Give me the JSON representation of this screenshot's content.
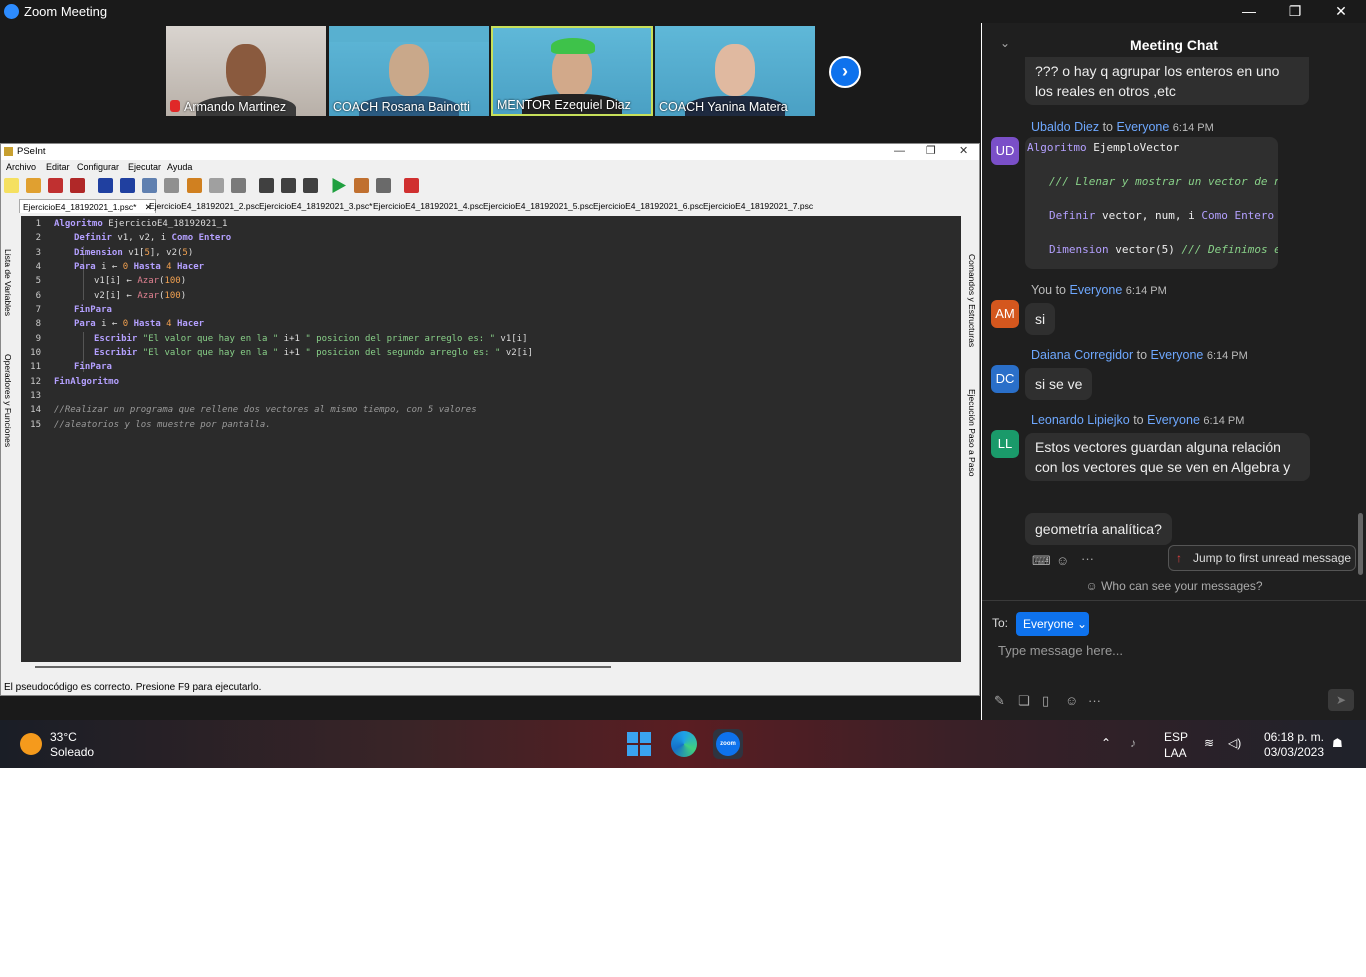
{
  "window": {
    "title": "Zoom Meeting",
    "minimize": "—",
    "restore": "❐",
    "close": "✕"
  },
  "participants": [
    {
      "name": "Armando Martinez",
      "muted": true
    },
    {
      "name": "COACH Rosana Bainotti",
      "muted": false
    },
    {
      "name": "MENTOR Ezequiel Diaz",
      "muted": false
    },
    {
      "name": "COACH Yanina Matera",
      "muted": false
    }
  ],
  "next_page_icon": "chevron-right-icon",
  "pseint": {
    "title": "PSeInt",
    "menu": [
      "Archivo",
      "Editar",
      "Configurar",
      "Ejecutar",
      "Ayuda"
    ],
    "tabs": [
      "EjercicioE4_18192021_1.psc*",
      "EjercicioE4_18192021_2.psc",
      "EjercicioE4_18192021_3.psc*",
      "EjercicioE4_18192021_4.psc",
      "EjercicioE4_18192021_5.psc",
      "EjercicioE4_18192021_6.psc",
      "EjercicioE4_18192021_7.psc"
    ],
    "tab_close": "✕",
    "left_panel": {
      "variables": "Lista de Variables",
      "operators": "Operadores y Funciones"
    },
    "right_panel": {
      "commands": "Comandos y Estructuras",
      "step": "Ejecución Paso a Paso"
    },
    "line_numbers": [
      "1",
      "2",
      "3",
      "4",
      "5",
      "6",
      "7",
      "8",
      "9",
      "10",
      "11",
      "12",
      "13",
      "14",
      "15"
    ],
    "code": {
      "l1_kw": "Algoritmo",
      "l1_rest": " EjercicioE4_18192021_1",
      "l2_kw": "Definir",
      "l2_a": " v1, v2, i ",
      "l2_kw2": "Como Entero",
      "l3_kw": "Dimension",
      "l3_a": " v1[",
      "l3_n": "5",
      "l3_b": "], v2(",
      "l3_n2": "5",
      "l3_c": ")",
      "l4_kw": "Para",
      "l4_a": " i ",
      "l4_op": "←",
      "l4_n": " 0 ",
      "l4_kw2": "Hasta",
      "l4_n2": " 4 ",
      "l4_kw3": "Hacer",
      "l5_a": "v1[i] ",
      "l5_op": "←",
      "l5_fn": " Azar",
      "l5_b": "(",
      "l5_n": "100",
      "l5_c": ")",
      "l6_a": "v2[i] ",
      "l6_op": "←",
      "l6_fn": " Azar",
      "l6_b": "(",
      "l6_n": "100",
      "l6_c": ")",
      "l7_kw": "FinPara",
      "l8_kw": "Para",
      "l8_a": " i ",
      "l8_op": "←",
      "l8_n": " 0 ",
      "l8_kw2": "Hasta",
      "l8_n2": " 4 ",
      "l8_kw3": "Hacer",
      "l9_kw": "Escribir",
      "l9_s1": " \"El valor que hay en la \"",
      "l9_a": " i+1 ",
      "l9_s2": "\" posicion del primer arreglo es: \"",
      "l9_b": " v1[i]",
      "l10_kw": "Escribir",
      "l10_s1": " \"El valor que hay en la \"",
      "l10_a": " i+1 ",
      "l10_s2": "\" posicion del segundo arreglo es: \"",
      "l10_b": " v2[i]",
      "l11_kw": "FinPara",
      "l12_kw": "FinAlgoritmo",
      "l14_cm": "//Realizar un programa que rellene dos vectores al mismo tiempo, con 5 valores",
      "l15_cm": "//aleatorios y los muestre por pantalla."
    },
    "status": "El pseudocódigo es correcto. Presione F9 para ejecutarlo."
  },
  "chat": {
    "title": "Meeting Chat",
    "collapse_icon": "chevron-down-icon",
    "prev_text": "??? o hay q agrupar los enteros en uno los reales en otros ,etc",
    "messages": [
      {
        "initials": "UD",
        "sender": "Ubaldo Diez",
        "to": "to",
        "target": "Everyone",
        "time": "6:14 PM",
        "color": "#7a4fc8",
        "code": {
          "kw": "Algoritmo",
          "name": " EjemploVector",
          "cm": "/// Llenar y mostrar un vector de num",
          "kw2": "Definir",
          "vars": " vector, num, i ",
          "kw3": "Como Entero",
          "kw4": "Dimension",
          "dim": " vector(5) ",
          "cm2": "/// Definimos el"
        }
      },
      {
        "initials": "AM",
        "sender": "You",
        "to": "to",
        "target": "Everyone",
        "time": "6:14 PM",
        "color": "#d4571e",
        "text": "si"
      },
      {
        "initials": "DC",
        "sender": "Daiana Corregidor",
        "to": "to",
        "target": "Everyone",
        "time": "6:14 PM",
        "color": "#2a6fc9",
        "text": "si se ve"
      },
      {
        "initials": "LL",
        "sender": "Leonardo Lipiejko",
        "to": "to",
        "target": "Everyone",
        "time": "6:14 PM",
        "color": "#1a9a6a",
        "text": "Estos vectores guardan alguna relación con los vectores que se ven en Algebra y",
        "text2": "geometría analítica?"
      }
    ],
    "jump_label": "Jump to first unread message",
    "who_can_see": "Who can see your messages?",
    "to_label": "To:",
    "to_value": "Everyone",
    "input_placeholder": "Type message here..."
  },
  "taskbar": {
    "temperature": "33°C",
    "condition": "Soleado",
    "language": "ESP",
    "layout": "LAA",
    "time": "06:18 p. m.",
    "date": "03/03/2023"
  }
}
